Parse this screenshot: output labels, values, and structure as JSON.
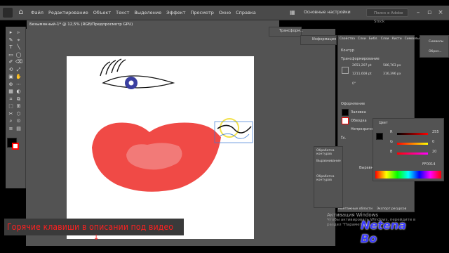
{
  "menubar": {
    "items": [
      "Файл",
      "Редактирование",
      "Объект",
      "Текст",
      "Выделение",
      "Эффект",
      "Просмотр",
      "Окно",
      "Справка"
    ],
    "workspace": "Основные настройки",
    "search_placeholder": "Поиск в Adobe Stock"
  },
  "document_tab": "Безымянный-1* @ 12,5% (RGB/Предпросмотр GPU)",
  "panels": {
    "transform_tab": "Трансформ...",
    "info_tab": "Информация",
    "properties": {
      "tabs": [
        "Свойства",
        "Слои",
        "Библ.",
        "Слои",
        "Кисти",
        "Символы"
      ],
      "section_contour": "Контур",
      "section_transform": "Трансформирование",
      "x": "2651,207 pt",
      "y": "1211,608 pt",
      "w": "586,763 px",
      "h": "316,396 px",
      "angle": "0°",
      "section_appearance": "Оформление",
      "fill_label": "Заливка",
      "stroke_label": "Обводка",
      "opacity_label": "Непрозрачность"
    },
    "color_panel": {
      "title": "Цвет",
      "r_label": "R",
      "r_value": "255",
      "g_label": "G",
      "g_value": "0",
      "b_label": "B",
      "b_value": "20",
      "hex": "FF0014"
    },
    "pathfinder": {
      "title": "Обработка контуров",
      "align_label": "Выравнивание",
      "pathfinder_label": "Обработка контуров"
    },
    "align_label": "Выравнивание",
    "bottom_tabs": [
      "Монтажные области",
      "Экспорт ресурсов"
    ],
    "right_tabs": [
      "Образ...",
      "Символы"
    ]
  },
  "windows_activation": {
    "line1": "Активация Windows",
    "line2": "Чтобы активировать Windows, перейдите в",
    "line3": "раздел \"Параметры\"."
  },
  "banner_text": "Горячие клавиши в описании под видео",
  "watermark_text": "Netena Bo",
  "colors": {
    "lips": "#f04a46",
    "lips_inner": "#f27a78",
    "iris": "#3a3fa0",
    "selection": "#3a7bd5",
    "highlight_circle": "#f2e14b"
  }
}
